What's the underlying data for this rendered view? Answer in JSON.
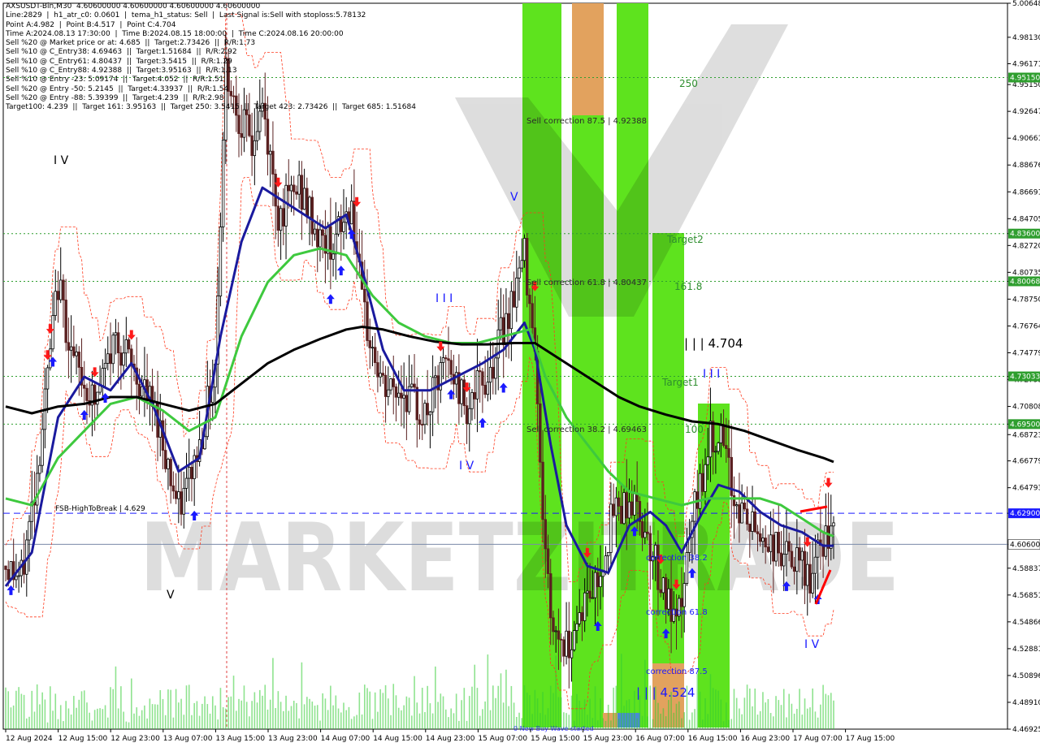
{
  "info_lines": [
    "AXSUSDT-Bin,M30  4.60600000 4.60600000 4.60600000 4.60600000",
    "Line:2829  |  h1_atr_c0: 0.0601  |  tema_h1_status: Sell  |  Last Signal is:Sell with stoploss:5.78132",
    "Point A:4.982  |  Point B:4.517  |  Point C:4.704",
    "Time A:2024.08.13 17:30:00  |  Time B:2024.08.15 18:00:00  |  Time C:2024.08.16 20:00:00",
    "Sell %20 @ Market price or at: 4.685  ||  Target:2.73426  ||  R/R:1.73",
    "Sell %10 @ C_Entry38: 4.69463  ||  Target:1.51684  ||  R/R:2.92",
    "Sell %10 @ C_Entry61: 4.80437  ||  Target:3.5415  ||  R/R:1.29",
    "Sell %10 @ C_Entry88: 4.92388  ||  Target:3.95163  ||  R/R:1.13",
    "Sell %10 @ Entry -23: 5.09174  ||  Target:4.052  ||  R/R:1.51",
    "Sell %20 @ Entry -50: 5.2145  ||  Target:4.33937  ||  R/R:1.54",
    "Sell %20 @ Entry -88: 5.39399  ||  Target:4.239  ||  R/R:2.98",
    "Target100: 4.239  ||  Target 161: 3.95163  ||  Target 250: 3.5415  ||  Target 423: 2.73426  ||  Target 685: 1.51684"
  ],
  "watermark": "MARKETZITRADE",
  "colors": {
    "bull_candle": "#000000",
    "bear_candle": "#5a2020",
    "ma_fast": "#1a1a9e",
    "ma_mid": "#3ec93e",
    "ma_slow": "#000000",
    "channel": "#ff3b1f",
    "zone_green": "#5ee31e",
    "zone_orange": "#e2a25e",
    "level_green": "#2e9e2e",
    "level_blue": "#1a1aff",
    "price_line": "#7a8aa8"
  },
  "annotations": {
    "fsb_label": "FSB-HighToBreak  |  4.629",
    "sell_corr_875": "Sell correction 87.5  |  4.92388",
    "sell_corr_618": "Sell correction 61.8  |  4.80437",
    "sell_corr_382": "Sell correction 38.2  |  4.69463",
    "lvl_250": "250",
    "lvl_1618": "161.8",
    "lvl_100": "100",
    "target2": "Target2",
    "target1": "Target1",
    "wave_c_price": "| | | 4.704",
    "wave_b_price": "| | | 4.524",
    "corr_382": "correction 38.2",
    "corr_618": "correction 61.8",
    "corr_875": "correction 87.5",
    "wave_iv_1": "I V",
    "wave_v_1": "V",
    "wave_iii": "I I I",
    "wave_iv_2": "I V",
    "wave_v_2": "V",
    "wave_iii_2": "I I I",
    "wave_iv_3": "I V",
    "bottom_note": "0 New Buy Wave started"
  },
  "chart_data": {
    "type": "candlestick",
    "symbol": "AXSUSDT-Bin",
    "timeframe": "M30",
    "ylim": [
      4.46925,
      5.00648
    ],
    "y_ticks": [
      5.00648,
      4.9813,
      4.96171,
      4.94632,
      4.92647,
      4.90661,
      4.88676,
      4.86691,
      4.84705,
      4.836,
      4.8272,
      4.80735,
      4.80068,
      4.7875,
      4.76764,
      4.74779,
      4.73033,
      4.72793,
      4.70808,
      4.695,
      4.68723,
      4.66779,
      4.64793,
      4.629,
      4.606,
      4.58837,
      4.56851,
      4.54866,
      4.52881,
      4.50896,
      4.4891,
      4.46925
    ],
    "y_tick_labels": [
      "5.00648",
      "4.98130",
      "4.96171",
      "4.95150",
      "4.92647",
      "4.90661",
      "4.88676",
      "4.86691",
      "4.84705",
      "4.83600",
      "4.82720",
      "4.80735",
      "4.80068",
      "4.78750",
      "4.76764",
      "4.74779",
      "4.73033",
      "4.72793",
      "4.70808",
      "4.69500",
      "4.68723",
      "4.66779",
      "4.64793",
      "4.62900",
      "4.60600",
      "4.58837",
      "4.56851",
      "4.54866",
      "4.52881",
      "4.50896",
      "4.48910",
      "4.46925"
    ],
    "x_labels": [
      "12 Aug 2024",
      "12 Aug 15:00",
      "12 Aug 23:00",
      "13 Aug 07:00",
      "13 Aug 15:00",
      "13 Aug 23:00",
      "14 Aug 07:00",
      "14 Aug 15:00",
      "14 Aug 23:00",
      "15 Aug 07:00",
      "15 Aug 15:00",
      "15 Aug 23:00",
      "16 Aug 07:00",
      "16 Aug 15:00",
      "16 Aug 23:00",
      "17 Aug 07:00",
      "17 Aug 15:00"
    ],
    "levels": [
      {
        "label": "4.95150",
        "value": 4.9515,
        "color": "green",
        "style": "dotted"
      },
      {
        "label": "4.83600",
        "value": 4.836,
        "color": "green",
        "style": "dotted"
      },
      {
        "label": "4.80068",
        "value": 4.80068,
        "color": "green",
        "style": "dotted"
      },
      {
        "label": "4.73033",
        "value": 4.73033,
        "color": "green",
        "style": "dotted"
      },
      {
        "label": "4.69500",
        "value": 4.695,
        "color": "green",
        "style": "dotted"
      },
      {
        "label": "4.62900",
        "value": 4.629,
        "color": "blue",
        "style": "dashed"
      },
      {
        "label": "4.60600",
        "value": 4.606,
        "color": "gray",
        "style": "solid"
      }
    ],
    "price_anchors": [
      [
        0,
        4.59
      ],
      [
        6,
        4.58
      ],
      [
        12,
        4.66
      ],
      [
        20,
        4.8
      ],
      [
        26,
        4.74
      ],
      [
        34,
        4.71
      ],
      [
        42,
        4.76
      ],
      [
        50,
        4.73
      ],
      [
        58,
        4.7
      ],
      [
        66,
        4.63
      ],
      [
        74,
        4.68
      ],
      [
        80,
        4.74
      ],
      [
        84,
        4.96
      ],
      [
        88,
        4.93
      ],
      [
        94,
        4.9
      ],
      [
        98,
        4.93
      ],
      [
        104,
        4.85
      ],
      [
        112,
        4.87
      ],
      [
        120,
        4.83
      ],
      [
        126,
        4.83
      ],
      [
        132,
        4.86
      ],
      [
        136,
        4.78
      ],
      [
        144,
        4.72
      ],
      [
        152,
        4.72
      ],
      [
        160,
        4.7
      ],
      [
        168,
        4.74
      ],
      [
        176,
        4.71
      ],
      [
        184,
        4.73
      ],
      [
        192,
        4.78
      ],
      [
        198,
        4.82
      ],
      [
        202,
        4.76
      ],
      [
        204,
        4.66
      ],
      [
        208,
        4.55
      ],
      [
        214,
        4.53
      ],
      [
        220,
        4.56
      ],
      [
        226,
        4.58
      ],
      [
        232,
        4.63
      ],
      [
        238,
        4.64
      ],
      [
        244,
        4.62
      ],
      [
        250,
        4.58
      ],
      [
        256,
        4.54
      ],
      [
        262,
        4.62
      ],
      [
        268,
        4.68
      ],
      [
        272,
        4.69
      ],
      [
        278,
        4.64
      ],
      [
        284,
        4.62
      ],
      [
        290,
        4.61
      ],
      [
        296,
        4.6
      ],
      [
        302,
        4.59
      ],
      [
        308,
        4.58
      ],
      [
        312,
        4.61
      ],
      [
        316,
        4.61
      ]
    ],
    "series": [
      {
        "name": "ma_fast",
        "color": "#1a1a9e",
        "points": [
          [
            0,
            4.575
          ],
          [
            10,
            4.6
          ],
          [
            20,
            4.7
          ],
          [
            30,
            4.73
          ],
          [
            40,
            4.72
          ],
          [
            48,
            4.74
          ],
          [
            56,
            4.71
          ],
          [
            66,
            4.66
          ],
          [
            74,
            4.67
          ],
          [
            82,
            4.76
          ],
          [
            90,
            4.83
          ],
          [
            98,
            4.87
          ],
          [
            106,
            4.86
          ],
          [
            114,
            4.85
          ],
          [
            122,
            4.84
          ],
          [
            130,
            4.85
          ],
          [
            136,
            4.81
          ],
          [
            144,
            4.75
          ],
          [
            152,
            4.72
          ],
          [
            162,
            4.72
          ],
          [
            172,
            4.73
          ],
          [
            182,
            4.74
          ],
          [
            190,
            4.75
          ],
          [
            198,
            4.77
          ],
          [
            202,
            4.75
          ],
          [
            208,
            4.68
          ],
          [
            214,
            4.62
          ],
          [
            222,
            4.59
          ],
          [
            230,
            4.585
          ],
          [
            238,
            4.62
          ],
          [
            246,
            4.63
          ],
          [
            252,
            4.62
          ],
          [
            258,
            4.6
          ],
          [
            266,
            4.63
          ],
          [
            272,
            4.65
          ],
          [
            280,
            4.645
          ],
          [
            288,
            4.63
          ],
          [
            296,
            4.62
          ],
          [
            304,
            4.615
          ],
          [
            312,
            4.605
          ],
          [
            316,
            4.605
          ]
        ]
      },
      {
        "name": "ma_mid",
        "color": "#3ec93e",
        "points": [
          [
            0,
            4.64
          ],
          [
            10,
            4.635
          ],
          [
            20,
            4.67
          ],
          [
            30,
            4.69
          ],
          [
            40,
            4.71
          ],
          [
            50,
            4.715
          ],
          [
            60,
            4.705
          ],
          [
            70,
            4.69
          ],
          [
            80,
            4.7
          ],
          [
            90,
            4.76
          ],
          [
            100,
            4.8
          ],
          [
            110,
            4.82
          ],
          [
            120,
            4.825
          ],
          [
            130,
            4.82
          ],
          [
            140,
            4.79
          ],
          [
            150,
            4.77
          ],
          [
            160,
            4.76
          ],
          [
            170,
            4.755
          ],
          [
            180,
            4.755
          ],
          [
            190,
            4.76
          ],
          [
            200,
            4.765
          ],
          [
            206,
            4.73
          ],
          [
            214,
            4.7
          ],
          [
            222,
            4.68
          ],
          [
            230,
            4.66
          ],
          [
            238,
            4.645
          ],
          [
            248,
            4.64
          ],
          [
            258,
            4.635
          ],
          [
            268,
            4.64
          ],
          [
            278,
            4.64
          ],
          [
            288,
            4.64
          ],
          [
            296,
            4.635
          ],
          [
            304,
            4.625
          ],
          [
            312,
            4.615
          ],
          [
            316,
            4.612
          ]
        ]
      },
      {
        "name": "ma_slow",
        "color": "#000000",
        "points": [
          [
            0,
            4.708
          ],
          [
            10,
            4.703
          ],
          [
            20,
            4.708
          ],
          [
            30,
            4.71
          ],
          [
            40,
            4.715
          ],
          [
            50,
            4.715
          ],
          [
            60,
            4.71
          ],
          [
            70,
            4.705
          ],
          [
            80,
            4.71
          ],
          [
            90,
            4.725
          ],
          [
            100,
            4.74
          ],
          [
            110,
            4.75
          ],
          [
            120,
            4.758
          ],
          [
            130,
            4.765
          ],
          [
            136,
            4.767
          ],
          [
            144,
            4.765
          ],
          [
            154,
            4.76
          ],
          [
            164,
            4.756
          ],
          [
            174,
            4.754
          ],
          [
            184,
            4.754
          ],
          [
            194,
            4.755
          ],
          [
            202,
            4.755
          ],
          [
            210,
            4.745
          ],
          [
            218,
            4.735
          ],
          [
            226,
            4.725
          ],
          [
            234,
            4.715
          ],
          [
            242,
            4.708
          ],
          [
            252,
            4.702
          ],
          [
            262,
            4.697
          ],
          [
            272,
            4.695
          ],
          [
            282,
            4.69
          ],
          [
            292,
            4.683
          ],
          [
            302,
            4.676
          ],
          [
            312,
            4.67
          ],
          [
            316,
            4.667
          ]
        ]
      }
    ]
  }
}
